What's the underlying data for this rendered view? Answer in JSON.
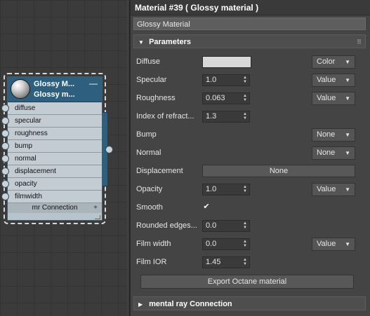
{
  "node": {
    "title_line1": "Glossy M...",
    "title_line2": "Glossy m...",
    "collapse": "—",
    "ports": [
      "diffuse",
      "specular",
      "roughness",
      "bump",
      "normal",
      "displacement",
      "opacity",
      "filmwidth"
    ],
    "connection": "mr Connection",
    "plus": "+"
  },
  "panel": {
    "title": "Material #39  ( Glossy material )",
    "material_name": "Glossy Material",
    "parameters_header": "Parameters",
    "mental_ray_header": "mental ray Connection",
    "grip": "⠿"
  },
  "params": {
    "diffuse": {
      "label": "Diffuse",
      "color": "#d8d8d8",
      "dropdown": "Color"
    },
    "specular": {
      "label": "Specular",
      "value": "1.0",
      "dropdown": "Value"
    },
    "roughness": {
      "label": "Roughness",
      "value": "0.063",
      "dropdown": "Value"
    },
    "ior": {
      "label": "Index of refract...",
      "value": "1.3"
    },
    "bump": {
      "label": "Bump",
      "dropdown": "None"
    },
    "normal": {
      "label": "Normal",
      "dropdown": "None"
    },
    "displacement": {
      "label": "Displacement",
      "button": "None"
    },
    "opacity": {
      "label": "Opacity",
      "value": "1.0",
      "dropdown": "Value"
    },
    "smooth": {
      "label": "Smooth",
      "check": "✔"
    },
    "rounded_edges": {
      "label": "Rounded edges...",
      "value": "0.0"
    },
    "film_width": {
      "label": "Film width",
      "value": "0.0",
      "dropdown": "Value"
    },
    "film_ior": {
      "label": "Film IOR",
      "value": "1.45"
    },
    "export_button": "Export Octane material"
  },
  "colors": {
    "node_header": "#2f5f7e",
    "panel_bg": "#444444",
    "diffuse_swatch": "#d8d8d8"
  }
}
